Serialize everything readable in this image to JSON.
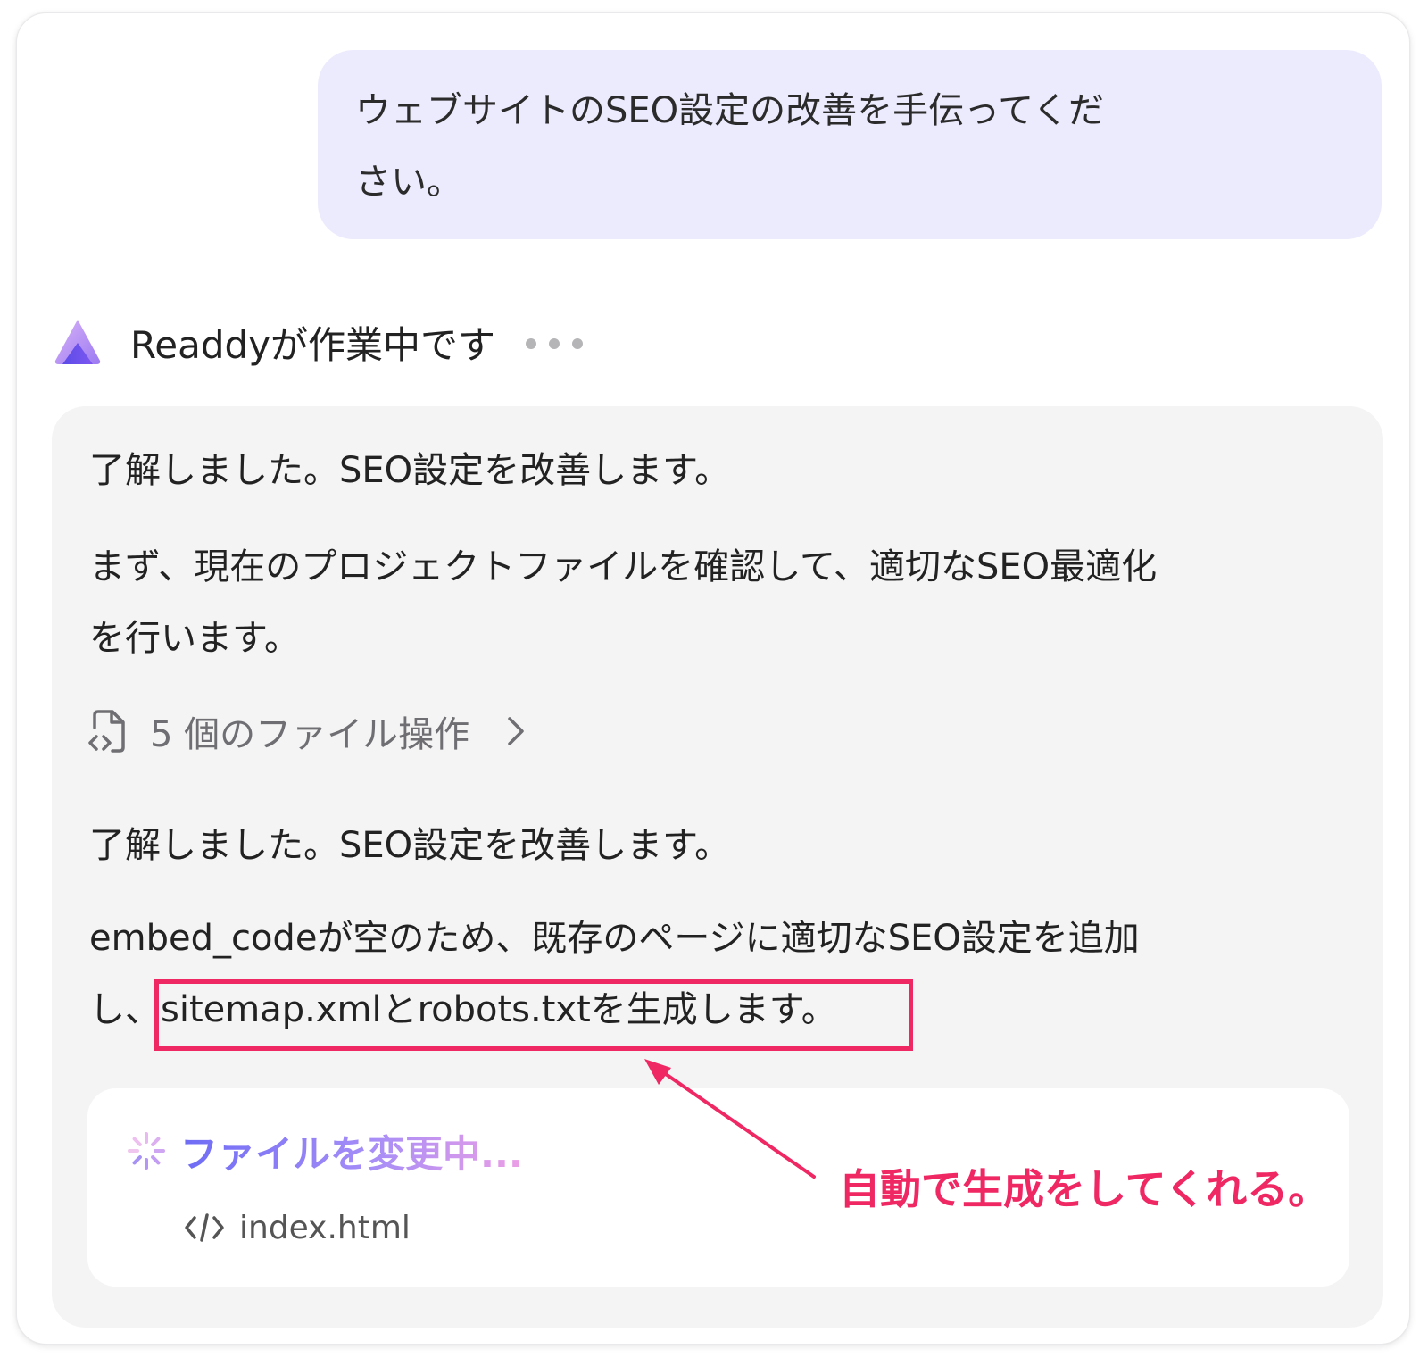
{
  "user_message": {
    "line1": "ウェブサイトのSEO設定の改善を手伝ってくだ",
    "line2": "さい。"
  },
  "status": {
    "text": "Readdyが作業中です",
    "logo_icon": "readdy-logo-icon",
    "loading_icon": "typing-dots-icon"
  },
  "response": {
    "p1": "了解しました。SEO設定を改善します。",
    "p2_line1": "まず、現在のプロジェクトファイルを確認して、適切なSEO最適化",
    "p2_line2": "を行います。",
    "file_ops_label": "5 個のファイル操作",
    "p3": "了解しました。SEO設定を改善します。",
    "p4_line1": "embed_codeが空のため、既存のページに適切なSEO設定を追加",
    "p4_line2_prefix": "し、",
    "p4_line2_highlight": "sitemap.xmlとrobots.txtを生成します。"
  },
  "modifying_card": {
    "status": "ファイルを変更中...",
    "file_name": "index.html"
  },
  "annotation": {
    "text": "自動で生成をしてくれる。",
    "color": "#ef2763"
  },
  "colors": {
    "user_bubble": "#ecebfd",
    "panel": "#f4f4f4",
    "accent_start": "#6e6cf5",
    "accent_end": "#ec9fe6"
  }
}
